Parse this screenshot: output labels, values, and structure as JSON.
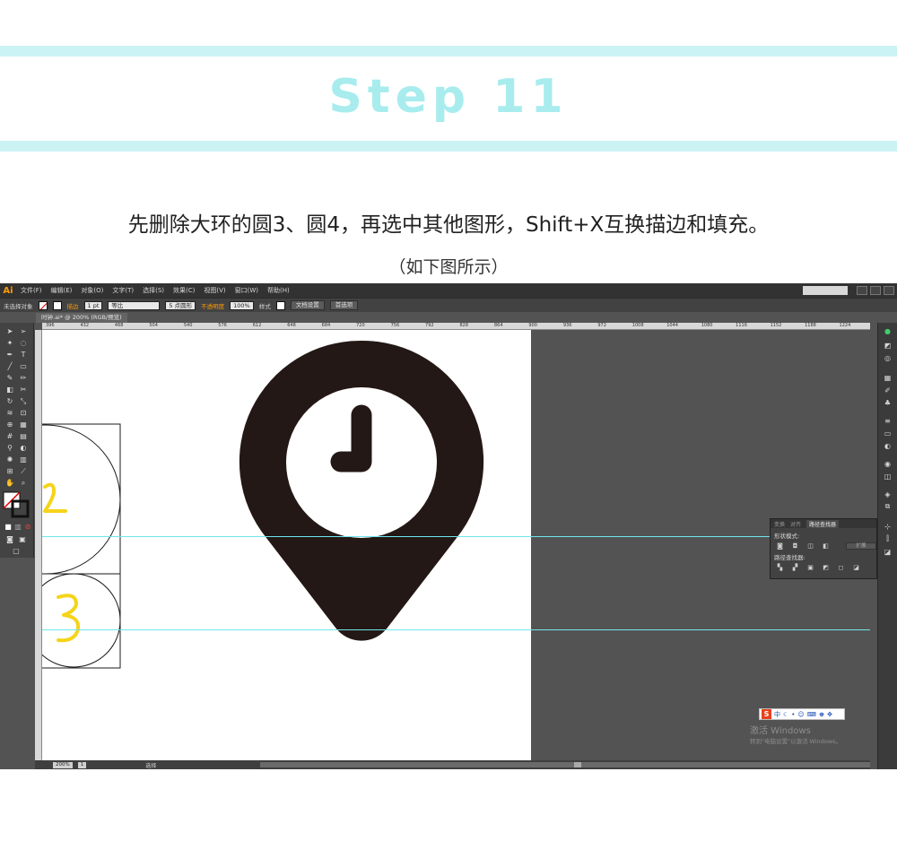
{
  "header": {
    "step_title": "Step 11",
    "instruction": "先删除大环的圆3、圆4，再选中其他图形，Shift+X互换描边和填充。",
    "caption": "（如下图所示）"
  },
  "app": {
    "logo": "Ai",
    "menu": [
      "文件(F)",
      "编辑(E)",
      "对象(O)",
      "文字(T)",
      "选择(S)",
      "效果(C)",
      "视图(V)",
      "窗口(W)",
      "帮助(H)"
    ],
    "control_bar": {
      "selection": "未选择对象",
      "stroke_label": "描边",
      "stroke_weight": "1 pt",
      "stroke_profile": "等比",
      "brush": "5 点圆形",
      "opacity_label": "不透明度",
      "opacity_value": "100%",
      "style_label": "样式",
      "doc_setup": "文档设置",
      "preferences": "首选项"
    },
    "doc_tab": "时钟.ai* @ 200% (RGB/预览)",
    "ruler_ticks": [
      "396",
      "432",
      "468",
      "504",
      "540",
      "576",
      "612",
      "648",
      "684",
      "720",
      "756",
      "792",
      "828",
      "864",
      "900",
      "936",
      "972",
      "1008",
      "1044",
      "1080",
      "1116",
      "1152",
      "1188",
      "1224"
    ],
    "pathfinder_panel": {
      "tabs": [
        "变换",
        "对齐",
        "路径查找器"
      ],
      "shape_modes_label": "形状模式:",
      "expand_label": "扩展",
      "pathfinders_label": "路径查找器:"
    },
    "status": {
      "zoom": "200%",
      "page": "1",
      "tool": "选择"
    },
    "annotations": [
      "2",
      "3"
    ],
    "windows_activation": {
      "title": "激活 Windows",
      "subtitle": "转到\"电脑设置\"以激活 Windows。"
    },
    "colors": {
      "icon_fill": "#231815",
      "guide": "#6fe6ec",
      "annotation": "#f5d41a",
      "band": "#cbf3f4",
      "step_title": "#a8ecee"
    }
  }
}
